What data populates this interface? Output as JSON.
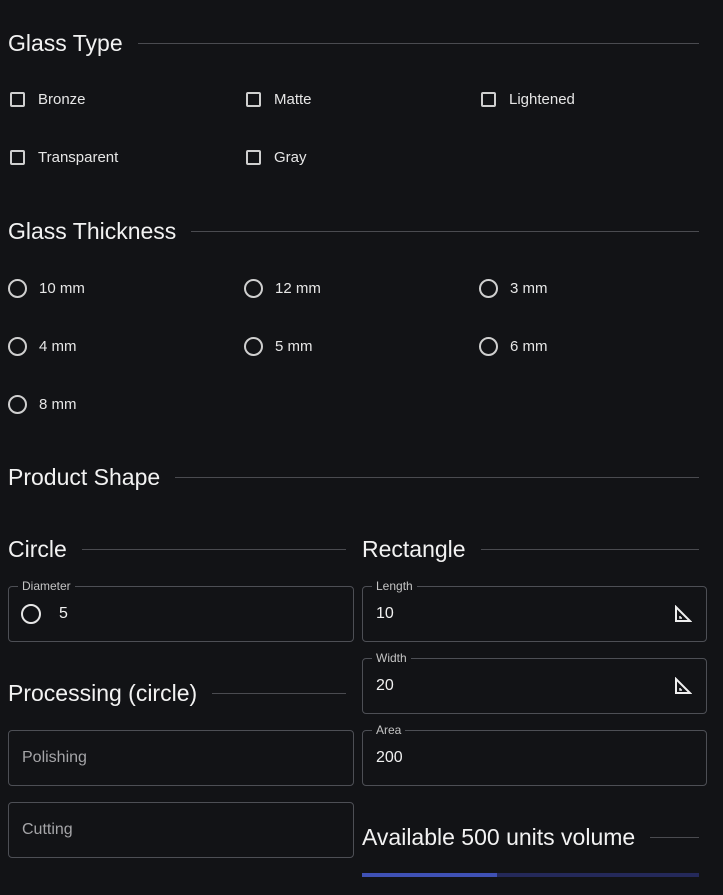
{
  "glass_type": {
    "title": "Glass Type",
    "options": [
      "Bronze",
      "Matte",
      "Lightened",
      "Transparent",
      "Gray"
    ]
  },
  "glass_thickness": {
    "title": "Glass Thickness",
    "options": [
      "10 mm",
      "12 mm",
      "3 mm",
      "4 mm",
      "5 mm",
      "6 mm",
      "8 mm"
    ]
  },
  "product_shape": {
    "title": "Product Shape",
    "circle": {
      "title": "Circle",
      "diameter_label": "Diameter",
      "diameter_value": "5"
    },
    "rectangle": {
      "title": "Rectangle",
      "length_label": "Length",
      "length_value": "10",
      "width_label": "Width",
      "width_value": "20",
      "area_label": "Area",
      "area_value": "200"
    }
  },
  "processing": {
    "title": "Processing (circle)",
    "polishing_placeholder": "Polishing",
    "cutting_placeholder": "Cutting"
  },
  "availability": {
    "title": "Available 500 units volume",
    "progress_fraction": 0.4
  },
  "colors": {
    "background": "#121316",
    "progress_fill": "#3f51b5",
    "progress_track": "#24295a"
  }
}
